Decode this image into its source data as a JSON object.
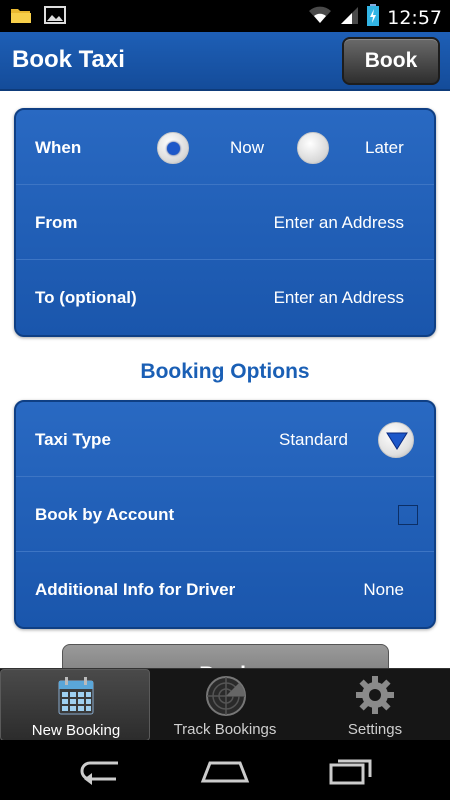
{
  "status_bar": {
    "time": "12:57",
    "icons": [
      "folder-icon",
      "image-icon",
      "wifi-icon",
      "signal-icon",
      "battery-charging-icon"
    ]
  },
  "header": {
    "title": "Book Taxi",
    "book_label": "Book"
  },
  "trip": {
    "when_label": "When",
    "now_label": "Now",
    "later_label": "Later",
    "selected": "Now",
    "from_label": "From",
    "from_placeholder": "Enter an Address",
    "to_label": "To (optional)",
    "to_placeholder": "Enter an Address"
  },
  "booking_options": {
    "title": "Booking Options",
    "taxi_type_label": "Taxi Type",
    "taxi_type_value": "Standard",
    "book_by_account_label": "Book by Account",
    "book_by_account_checked": false,
    "additional_info_label": "Additional Info for Driver",
    "additional_info_value": "None"
  },
  "bottom_button_label": "Book",
  "tabs": [
    {
      "label": "New Booking",
      "icon": "calendar-icon",
      "active": true
    },
    {
      "label": "Track Bookings",
      "icon": "radar-icon",
      "active": false
    },
    {
      "label": "Settings",
      "icon": "gear-icon",
      "active": false
    }
  ],
  "colors": {
    "header_blue": "#1a58a8",
    "panel_blue": "#2264bd",
    "section_title": "#1a5fb5"
  }
}
